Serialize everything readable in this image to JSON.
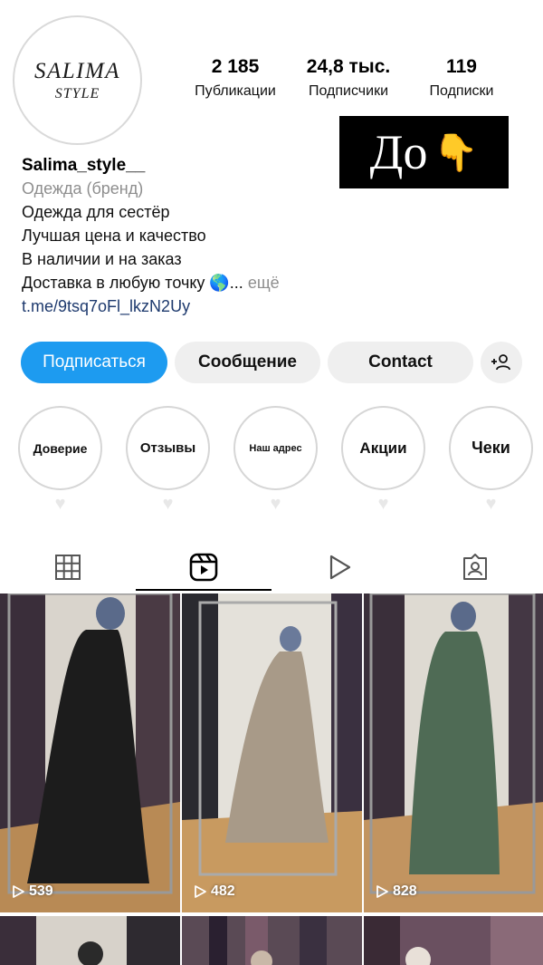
{
  "profile": {
    "avatar_line1": "SALIMA",
    "avatar_line2": "STYLE",
    "username": "Salima_style__",
    "category": "Одежда (бренд)",
    "bio_lines": [
      "Одежда для сестёр",
      "Лучшая цена и качество",
      "В наличии и на заказ"
    ],
    "bio_last_line": "Доставка в любую точку 🌎...",
    "bio_more": "ещё",
    "link": "t.me/9tsq7oFl_lkzN2Uy"
  },
  "stats": [
    {
      "value": "2 185",
      "label": "Публикации"
    },
    {
      "value": "24,8 тыс.",
      "label": "Подписчики"
    },
    {
      "value": "119",
      "label": "Подписки"
    }
  ],
  "promo": {
    "text": "До",
    "emoji": "👇"
  },
  "buttons": {
    "follow": "Подписаться",
    "message": "Сообщение",
    "contact": "Contact"
  },
  "highlights": [
    {
      "label": "Доверие"
    },
    {
      "label": "Отзывы"
    },
    {
      "label": "Наш адрес"
    },
    {
      "label": "Акции"
    },
    {
      "label": "Чеки"
    }
  ],
  "tabs": [
    "grid-icon",
    "reels-icon",
    "play-icon",
    "tagged-icon"
  ],
  "posts": [
    {
      "views": "539",
      "dress_color": "#1c1c1c"
    },
    {
      "views": "482",
      "dress_color": "#a89a88"
    },
    {
      "views": "828",
      "dress_color": "#4f6b55"
    }
  ],
  "colors": {
    "accent": "#1d9bf0",
    "button_gray": "#efefef",
    "link": "#1e3a6e",
    "muted": "#8e8e8e"
  }
}
